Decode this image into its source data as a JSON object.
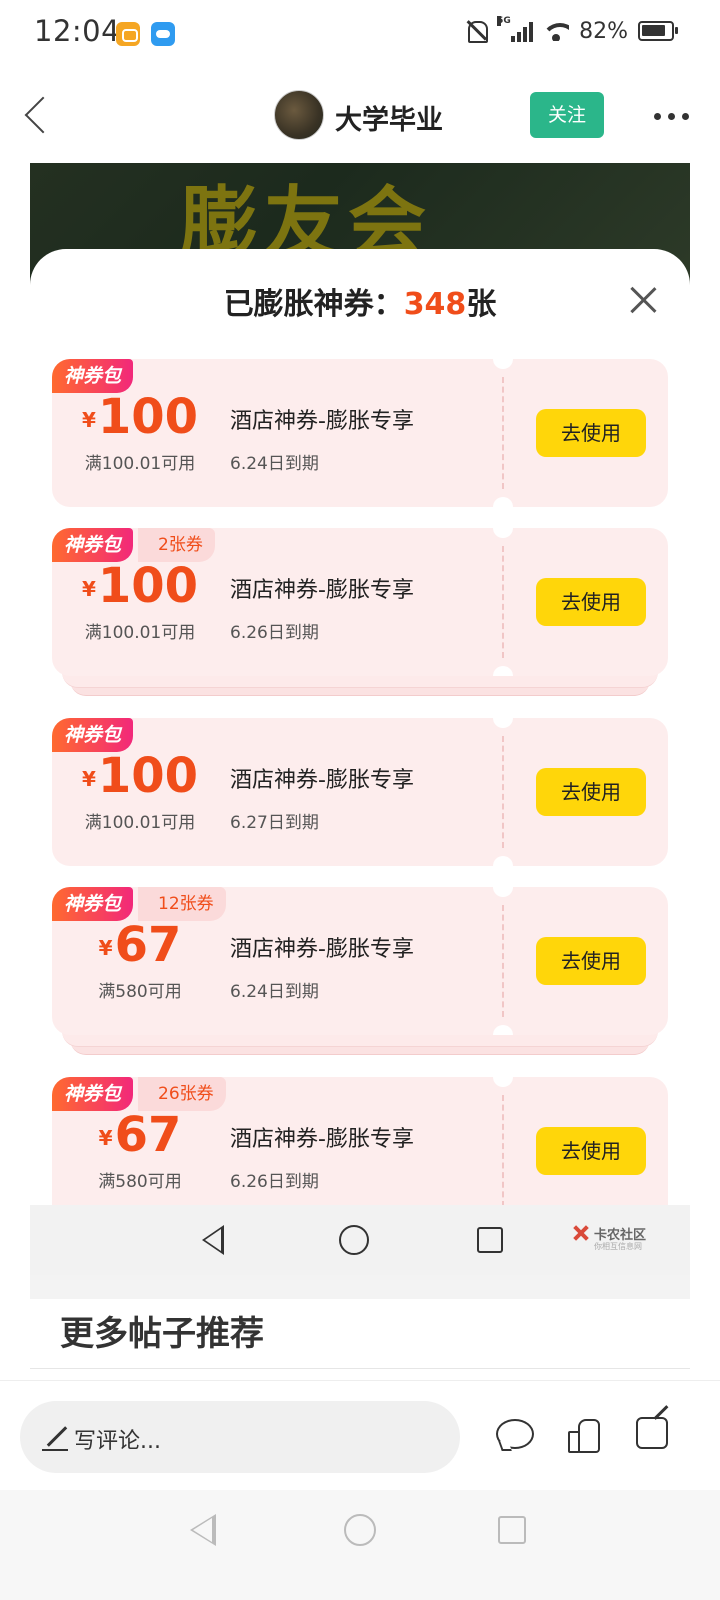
{
  "status_bar": {
    "time": "12:04",
    "network": "5G",
    "battery": "82%"
  },
  "header": {
    "title": "大学毕业",
    "follow_label": "关注"
  },
  "post_image": {
    "banner_text": "膨友会",
    "sheet": {
      "title_prefix": "已膨胀神券：",
      "count": "348",
      "title_suffix": "张"
    },
    "coupons": [
      {
        "tag": "神券包",
        "count_tag": "",
        "currency": "¥",
        "amount": "100",
        "condition": "满100.01可用",
        "name": "酒店神券-膨胀专享",
        "expire": "6.24日到期",
        "button": "去使用",
        "stacked": false
      },
      {
        "tag": "神券包",
        "count_tag": "2张券",
        "currency": "¥",
        "amount": "100",
        "condition": "满100.01可用",
        "name": "酒店神券-膨胀专享",
        "expire": "6.26日到期",
        "button": "去使用",
        "stacked": true
      },
      {
        "tag": "神券包",
        "count_tag": "",
        "currency": "¥",
        "amount": "100",
        "condition": "满100.01可用",
        "name": "酒店神券-膨胀专享",
        "expire": "6.27日到期",
        "button": "去使用",
        "stacked": false
      },
      {
        "tag": "神券包",
        "count_tag": "12张券",
        "currency": "¥",
        "amount": "67",
        "condition": "满580可用",
        "name": "酒店神券-膨胀专享",
        "expire": "6.24日到期",
        "button": "去使用",
        "stacked": true
      },
      {
        "tag": "神券包",
        "count_tag": "26张券",
        "currency": "¥",
        "amount": "67",
        "condition": "满580可用",
        "name": "酒店神券-膨胀专享",
        "expire": "6.26日到期",
        "button": "去使用",
        "stacked": false
      }
    ],
    "watermark": {
      "text": "卡农社区",
      "sub": "你相互信息网"
    }
  },
  "more_section": {
    "title": "更多帖子推荐"
  },
  "bottom_bar": {
    "comment_placeholder": "写评论..."
  },
  "colors": {
    "accent": "#f04d1a",
    "follow_button": "#2bb68a",
    "use_button": "#ffd60a",
    "coupon_bg": "#fdeded"
  }
}
